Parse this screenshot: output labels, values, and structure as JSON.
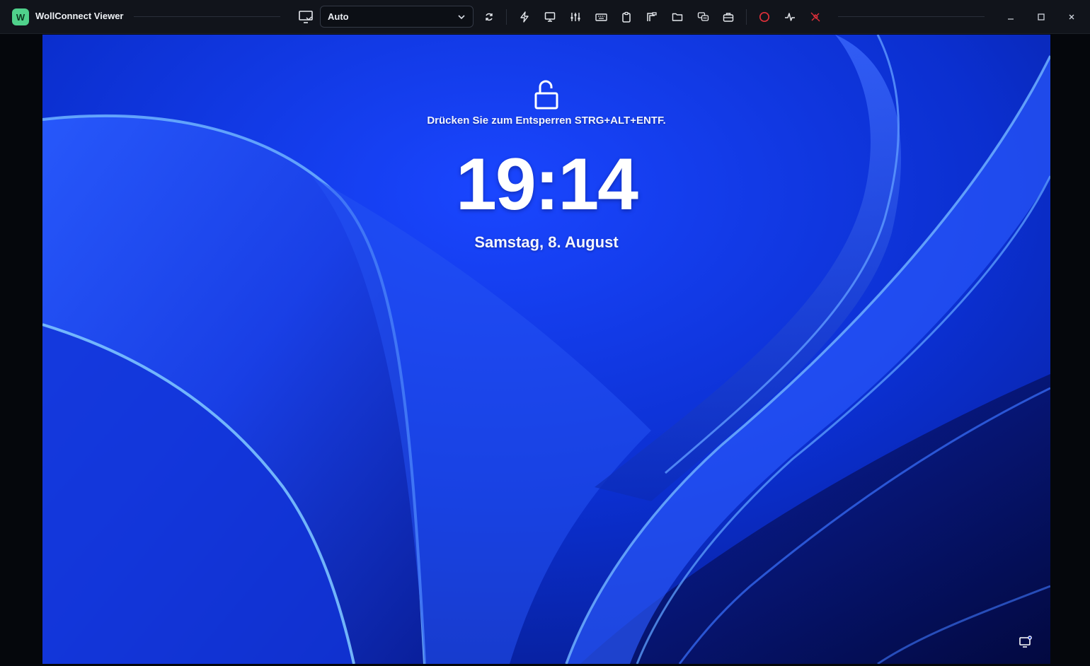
{
  "app": {
    "title": "WollConnect Viewer",
    "logo_letter": "W",
    "accent": "#4fd18b"
  },
  "toolbar": {
    "monitor_select": {
      "value": "Auto",
      "icon": "monitor-select-icon"
    },
    "buttons": [
      {
        "name": "refresh-icon"
      },
      {
        "name": "lightning-icon"
      },
      {
        "name": "display-icon"
      },
      {
        "name": "sliders-icon"
      },
      {
        "name": "keyboard-icon"
      },
      {
        "name": "clipboard-icon"
      },
      {
        "name": "transfer-icon"
      },
      {
        "name": "folder-icon"
      },
      {
        "name": "chat-icon"
      },
      {
        "name": "toolbox-icon"
      },
      {
        "name": "record-icon",
        "color": "#e0303a"
      },
      {
        "name": "activity-icon"
      },
      {
        "name": "disconnect-icon",
        "color": "#e0303a"
      }
    ]
  },
  "window_controls": [
    "minimize-icon",
    "maximize-icon",
    "close-icon"
  ],
  "lockscreen": {
    "hint": "Drücken Sie zum Entsperren STRG+ALT+ENTF.",
    "time": "19:14",
    "date": "Samstag, 8. August"
  }
}
